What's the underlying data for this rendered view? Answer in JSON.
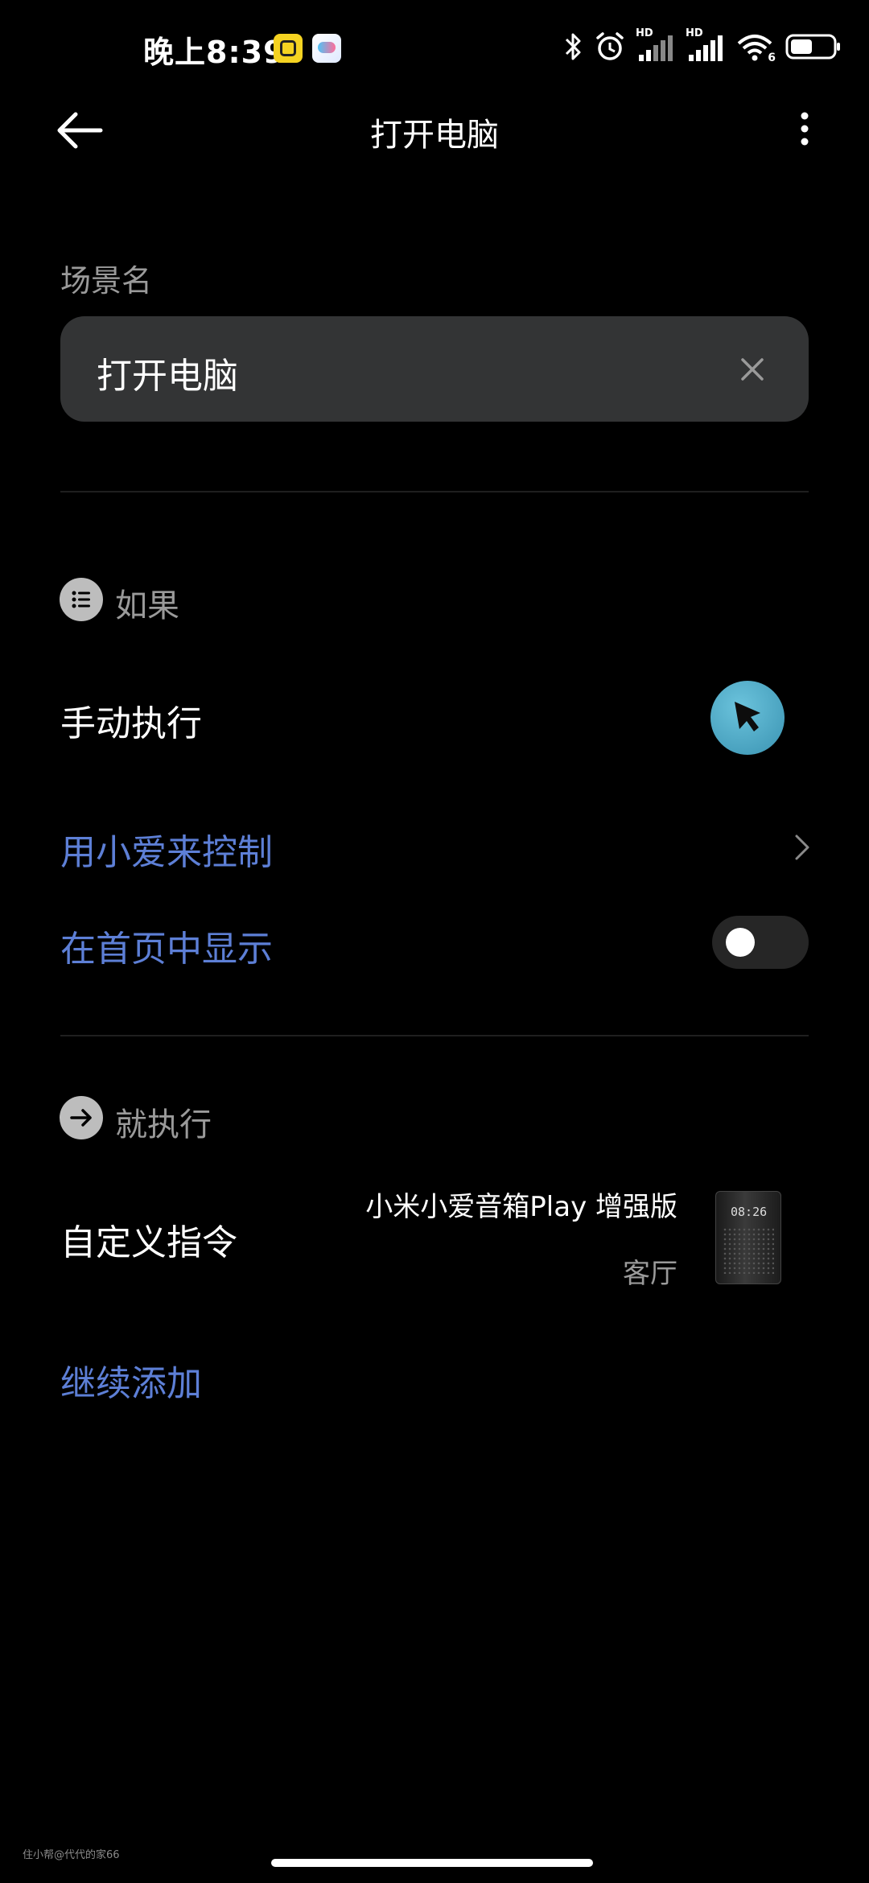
{
  "status_bar": {
    "time": "晚上8:39",
    "icons": [
      "app-badge-yellow",
      "app-badge-game",
      "bluetooth-icon",
      "alarm-icon",
      "signal-hd-icon",
      "signal-hd-icon",
      "wifi-icon",
      "battery-icon"
    ],
    "hd_label": "HD",
    "wifi_label": "6"
  },
  "header": {
    "title": "打开电脑",
    "back_icon": "arrow-left-icon",
    "more_icon": "more-vertical-icon"
  },
  "scene_name": {
    "label": "场景名",
    "value": "打开电脑",
    "clear_icon": "close-icon"
  },
  "if_section": {
    "title": "如果",
    "icon": "list-icon",
    "trigger_label": "手动执行",
    "trigger_icon": "cursor-icon",
    "xiaoai_link": "用小爱来控制",
    "show_home_label": "在首页中显示",
    "show_home_enabled": false
  },
  "then_section": {
    "title": "就执行",
    "icon": "arrow-right-icon",
    "action_label": "自定义指令",
    "device_name": "小米小爱音箱Play 增强版",
    "device_room": "客厅",
    "device_display": "08:26",
    "add_more": "继续添加"
  },
  "watermark": "住小帮@代代的家66",
  "colors": {
    "background": "#000000",
    "field": "#333435",
    "link": "#5d7fd6",
    "accent_button": "#4aa6c4",
    "secondary_text": "#9a9a9a"
  }
}
